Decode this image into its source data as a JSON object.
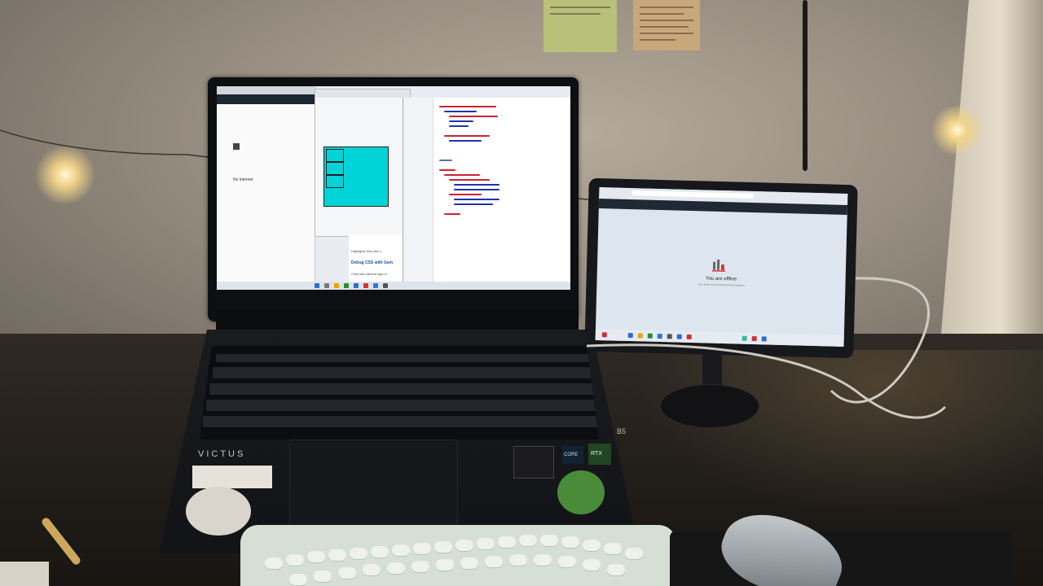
{
  "laptop": {
    "brand": "VICTUS",
    "key_brand": "B5",
    "screen": {
      "offline_title": "No internet",
      "sidebar_heading": "Debug CSS with Gem",
      "sidebar_caption": "Highlights from the c...",
      "sidebar_note": "Chat with camera sign in"
    },
    "gpu_label": "RTX",
    "cpu_label": "CORE"
  },
  "tablet": {
    "offline_title": "You are offline",
    "offline_subtitle": "Your device is not connected to the internet"
  }
}
